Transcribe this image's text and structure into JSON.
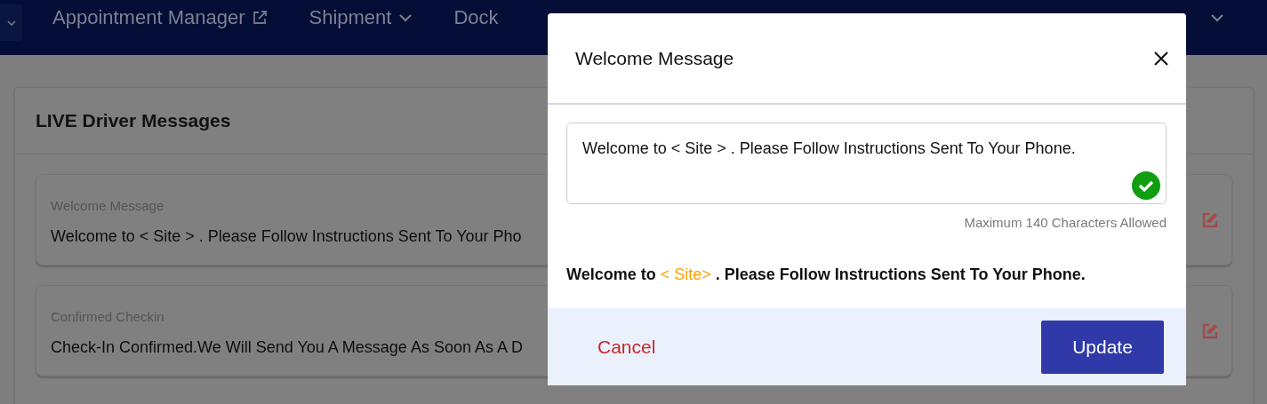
{
  "nav": {
    "items": [
      {
        "label": "Appointment Manager",
        "kind": "external"
      },
      {
        "label": "Shipment",
        "kind": "dropdown"
      },
      {
        "label": "Dock",
        "kind": "plain"
      }
    ]
  },
  "panel": {
    "title": "LIVE Driver Messages",
    "messages": [
      {
        "label": "Welcome Message",
        "text": "Welcome to < Site > . Please Follow Instructions Sent To Your Pho"
      },
      {
        "label": "Confirmed Checkin",
        "text": "Check-In Confirmed.We Will Send You A Message As Soon As A D"
      }
    ]
  },
  "dialog": {
    "title": "Welcome Message",
    "value": "Welcome to < Site > . Please Follow Instructions Sent To Your Phone.",
    "valid": true,
    "hint": "Maximum 140 Characters Allowed",
    "preview": [
      {
        "text": "Welcome to ",
        "highlighted": false
      },
      {
        "text": "< Site>",
        "highlighted": true
      },
      {
        "text": " . Please Follow Instructions Sent To Your Phone.",
        "highlighted": false
      }
    ],
    "buttons": [
      {
        "label": "Cancel",
        "kind": "text"
      },
      {
        "label": "Update",
        "kind": "primary"
      }
    ]
  }
}
